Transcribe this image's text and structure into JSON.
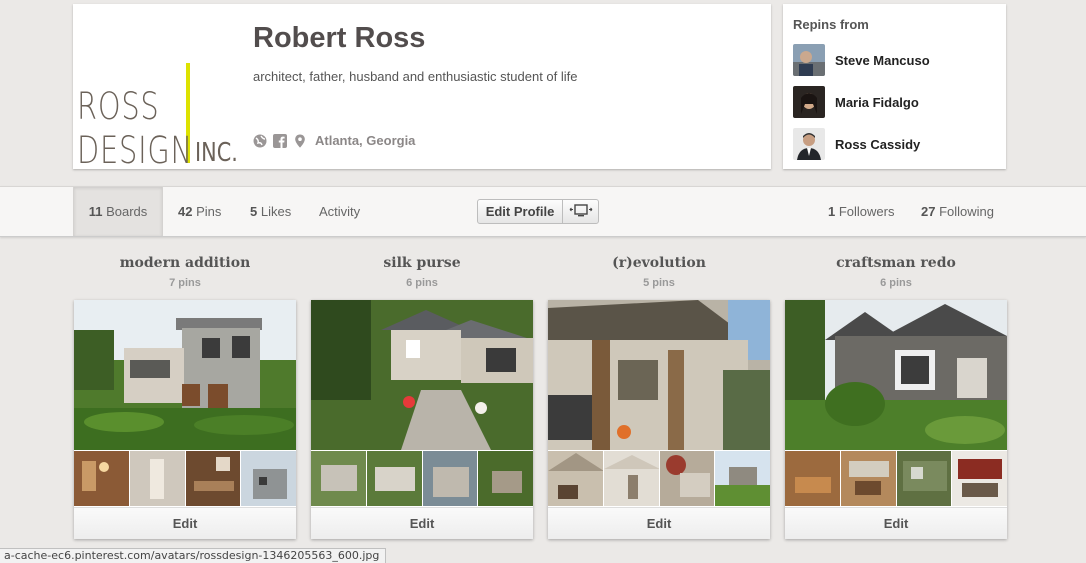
{
  "profile": {
    "name": "Robert Ross",
    "bio": "architect, father, husband and enthusiastic student of life",
    "location": "Atlanta, Georgia",
    "logo": {
      "line1": "ROSS",
      "line2": "DESIGN",
      "suffix": "INC."
    }
  },
  "repins": {
    "title": "Repins from",
    "users": [
      {
        "name": "Steve Mancuso"
      },
      {
        "name": "Maria Fidalgo"
      },
      {
        "name": "Ross Cassidy"
      }
    ]
  },
  "nav": {
    "boards_count": "11",
    "boards_label": "Boards",
    "pins_count": "42",
    "pins_label": "Pins",
    "likes_count": "5",
    "likes_label": "Likes",
    "activity_label": "Activity",
    "edit_profile_label": "Edit Profile",
    "followers_count": "1",
    "followers_label": "Followers",
    "following_count": "27",
    "following_label": "Following"
  },
  "boards": [
    {
      "title": "modern addition",
      "pins": "7 pins",
      "edit_label": "Edit"
    },
    {
      "title": "silk purse",
      "pins": "6 pins",
      "edit_label": "Edit"
    },
    {
      "title": "(r)evolution",
      "pins": "5 pins",
      "edit_label": "Edit"
    },
    {
      "title": "craftsman redo",
      "pins": "6 pins",
      "edit_label": "Edit"
    }
  ],
  "status_url": "a-cache-ec6.pinterest.com/avatars/rossdesign-1346205563_600.jpg",
  "colors": {
    "logo_bar": "#dde200",
    "logo_text": "#6b6259"
  },
  "icons": [
    "globe-icon",
    "facebook-icon",
    "location-pin-icon",
    "display-icon"
  ]
}
